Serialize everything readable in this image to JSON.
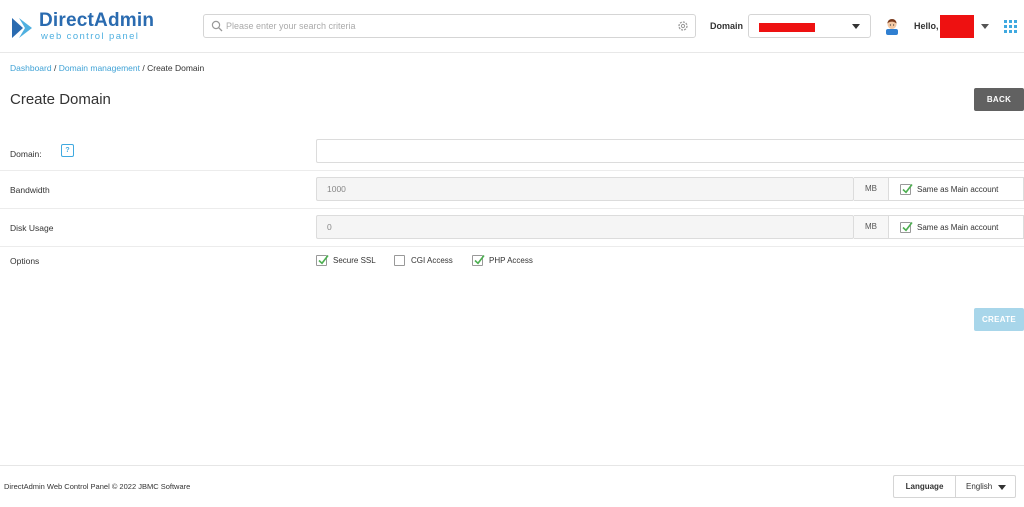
{
  "header": {
    "logo_title": "DirectAdmin",
    "logo_subtitle": "web control panel",
    "search_placeholder": "Please enter your search criteria",
    "domain_label": "Domain",
    "hello_text": "Hello,",
    "accent_color": "#3fa9e0",
    "redaction_color": "#ee1111"
  },
  "breadcrumb": {
    "items": [
      "Dashboard",
      "Domain management",
      "Create Domain"
    ],
    "separator": "/"
  },
  "page": {
    "title": "Create Domain",
    "back_label": "BACK",
    "create_label": "CREATE"
  },
  "form": {
    "domain": {
      "label": "Domain:",
      "help": "?",
      "value": ""
    },
    "bandwidth": {
      "label": "Bandwidth",
      "value": "1000",
      "unit": "MB",
      "same_label": "Same as Main account",
      "same_checked": true
    },
    "disk_usage": {
      "label": "Disk Usage",
      "value": "0",
      "unit": "MB",
      "same_label": "Same as Main account",
      "same_checked": true
    },
    "options": {
      "label": "Options",
      "items": [
        {
          "label": "Secure SSL",
          "checked": true
        },
        {
          "label": "CGI Access",
          "checked": false
        },
        {
          "label": "PHP Access",
          "checked": true
        }
      ]
    }
  },
  "footer": {
    "copyright": "DirectAdmin Web Control Panel © 2022 JBMC Software",
    "language_label": "Language",
    "language_value": "English"
  }
}
